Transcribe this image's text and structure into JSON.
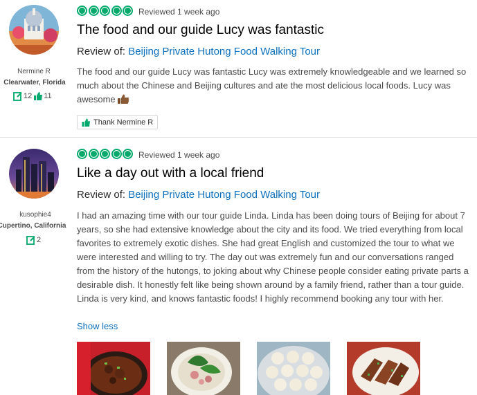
{
  "reviews": [
    {
      "user": {
        "name": "Nermine R",
        "location": "Clearwater, Florida",
        "contributions": "12",
        "helpful_votes": "11"
      },
      "rating": 5,
      "reviewed": "Reviewed 1 week ago",
      "title": "The food and our guide Lucy was fantastic",
      "review_of_label": "Review of:",
      "attraction": "Beijing Private Hutong Food Walking Tour",
      "body": "The food and our guide Lucy was fantastic Lucy was extremely knowledgeable and we learned so much about the Chinese and Beijing cultures and ate the most delicious local foods. Lucy was awesome",
      "thank_label": "Thank Nermine R"
    },
    {
      "user": {
        "name": "kusophie4",
        "location": "Cupertino, California",
        "contributions": "2"
      },
      "rating": 5,
      "reviewed": "Reviewed 1 week ago",
      "title": "Like a day out with a local friend",
      "review_of_label": "Review of:",
      "attraction": "Beijing Private Hutong Food Walking Tour",
      "body": "I had an amazing time with our tour guide Linda. Linda has been doing tours of Beijing for about 7 years, so she had extensive knowledge about the city and its food. We tried everything from local favorites to extremely exotic dishes. She had great English and customized the tour to what we were interested and willing to try. The day out was extremely fun and our conversations ranged from the history of the hutongs, to joking about why Chinese people consider eating private parts a desirable dish. It honestly felt like being shown around by a family friend, rather than a tour guide. Linda is very kind, and knows fantastic foods! I highly recommend booking any tour with her.",
      "show_less": "Show less",
      "photos": [
        "beef-noodle-soup-photo",
        "vegetable-dish-photo",
        "steamed-dumplings-photo",
        "sliced-meat-dish-photo"
      ]
    }
  ],
  "colors": {
    "rating": "#00aa6c",
    "link": "#0b6fbf",
    "text": "#4a4a4a",
    "title": "#000000"
  }
}
